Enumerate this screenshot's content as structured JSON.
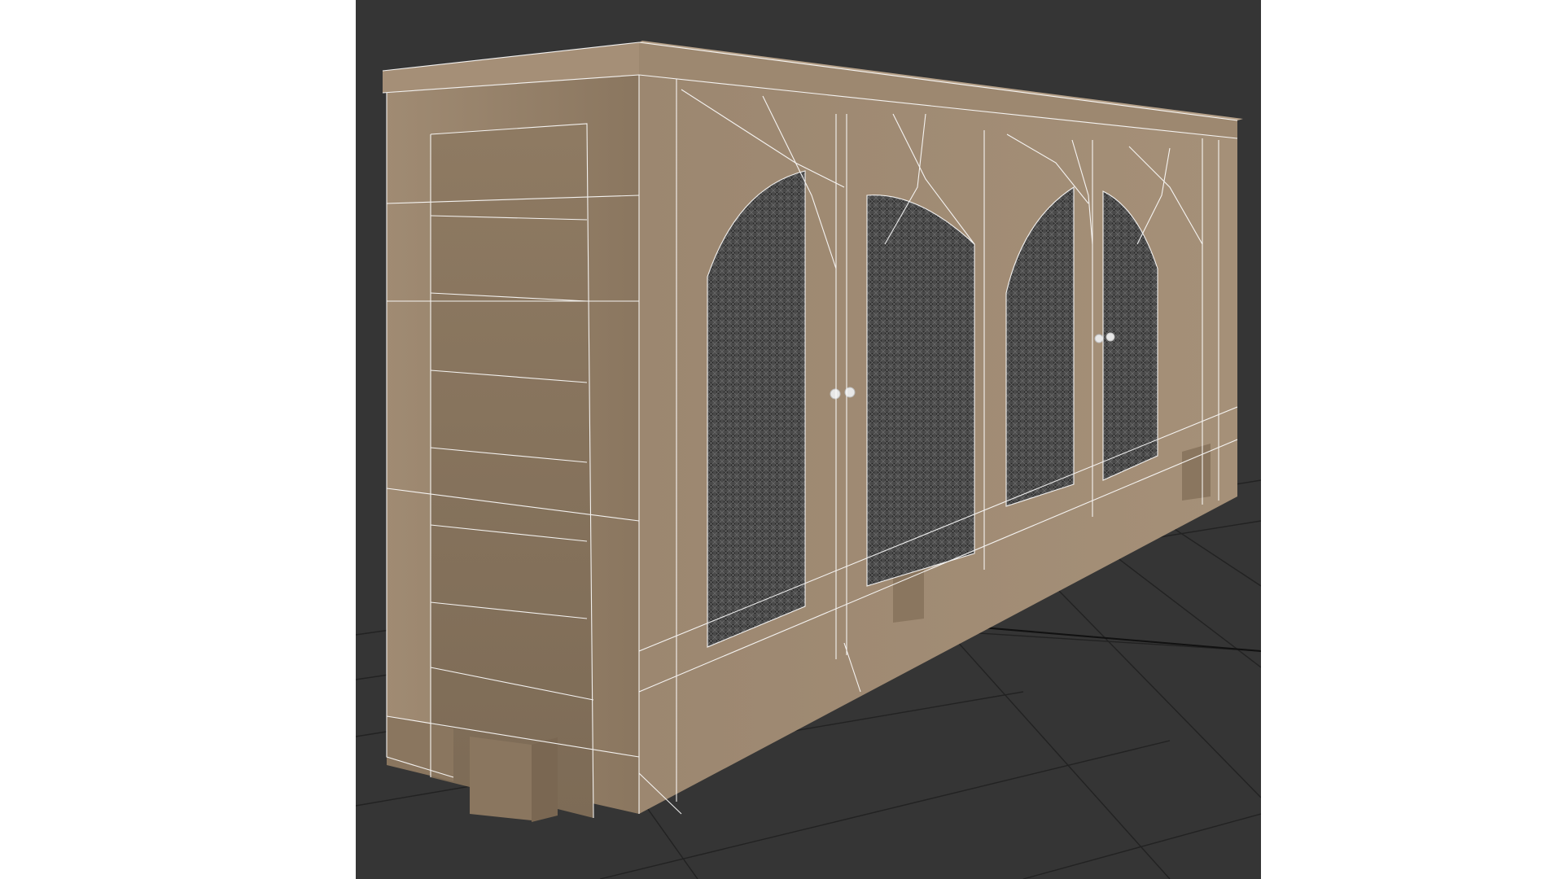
{
  "viewport": {
    "background_color": "#353535",
    "page_margin_color": "#ffffff",
    "shading_mode": "edged-faces",
    "wireframe_color": "#ffffff"
  },
  "scene": {
    "object": "sideboard-cabinet",
    "material_colors": {
      "wood_light": "#a38f78",
      "wood_mid": "#8f7b63",
      "wood_dark": "#76644f",
      "cane_mesh": "#3c3c3c"
    },
    "grid_color": "#1f1f1f"
  }
}
